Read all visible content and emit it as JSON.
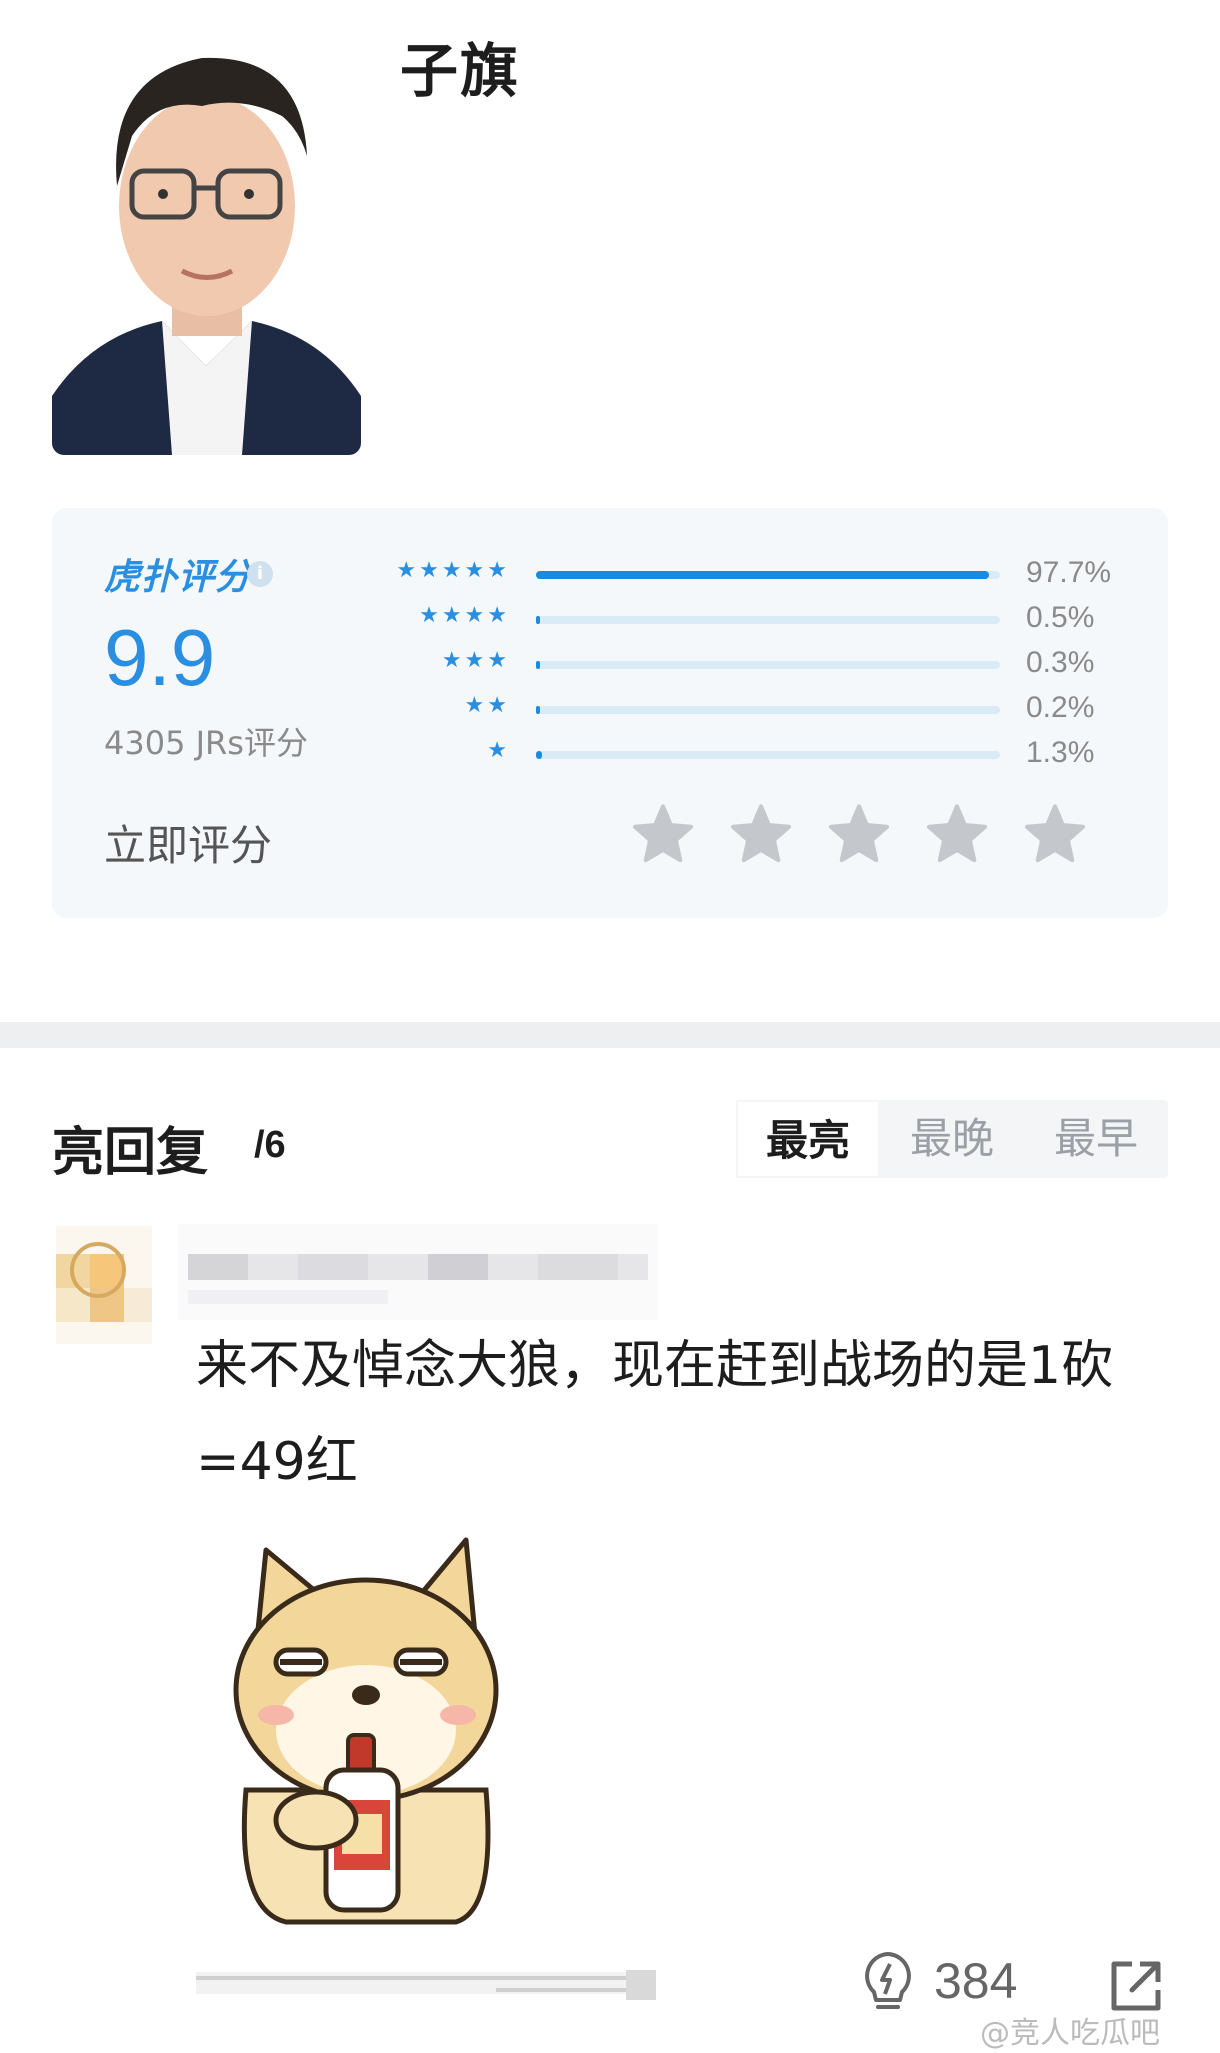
{
  "profile": {
    "name": "子旗"
  },
  "rating": {
    "brand": "虎扑评分",
    "score": "9.9",
    "count": "4305 JRs评分",
    "rate_now": "立即评分",
    "distribution": [
      {
        "stars": 5,
        "percent": "97.7%",
        "value": 97.7
      },
      {
        "stars": 4,
        "percent": "0.5%",
        "value": 0.5
      },
      {
        "stars": 3,
        "percent": "0.3%",
        "value": 0.3
      },
      {
        "stars": 2,
        "percent": "0.2%",
        "value": 0.2
      },
      {
        "stars": 1,
        "percent": "1.3%",
        "value": 1.3
      }
    ],
    "accent_color": "#2a8fe0"
  },
  "replies": {
    "title": "亮回复",
    "count": "/6",
    "tabs": [
      {
        "label": "最亮",
        "active": true
      },
      {
        "label": "最晚",
        "active": false
      },
      {
        "label": "最早",
        "active": false
      }
    ]
  },
  "comment": {
    "text": "来不及悼念大狼，现在赶到战场的是1砍=49红",
    "likes": "384"
  },
  "watermark": "@竞人吃瓜吧",
  "icons": [
    "info-icon",
    "star-icon",
    "lightbulb-icon",
    "share-icon"
  ]
}
